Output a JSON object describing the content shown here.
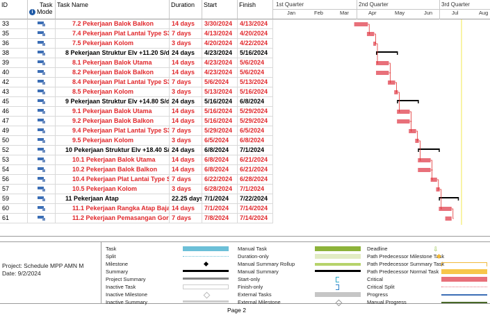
{
  "columns": {
    "id": "ID",
    "mode_line1": "Task",
    "mode_line2": "Mode",
    "name": "Task Name",
    "duration": "Duration",
    "start": "Start",
    "finish": "Finish"
  },
  "timescale": {
    "quarters": [
      "1st Quarter",
      "2nd Quarter",
      "3rd Quarter"
    ],
    "months": [
      "Jan",
      "Feb",
      "Mar",
      "Apr",
      "May",
      "Jun",
      "Jul",
      "Aug"
    ]
  },
  "tasks": [
    {
      "id": "33",
      "name": "7.2 Pekerjaan Balok Balkon",
      "duration": "14 days",
      "start": "3/30/2024",
      "finish": "4/13/2024",
      "type": "task"
    },
    {
      "id": "35",
      "name": "7.4 Pekerjaan Plat Lantai Type S3",
      "duration": "7 days",
      "start": "4/13/2024",
      "finish": "4/20/2024",
      "type": "task"
    },
    {
      "id": "36",
      "name": "7.5 Pekerjaan Kolom",
      "duration": "3 days",
      "start": "4/20/2024",
      "finish": "4/22/2024",
      "type": "task"
    },
    {
      "id": "38",
      "name": "8 Pekerjaan Struktur Elv +11.20  S/d +1(",
      "duration": "24 days",
      "start": "4/23/2024",
      "finish": "5/16/2024",
      "type": "summary"
    },
    {
      "id": "39",
      "name": "8.1 Pekerjaan Balok Utama",
      "duration": "14 days",
      "start": "4/23/2024",
      "finish": "5/6/2024",
      "type": "task"
    },
    {
      "id": "40",
      "name": "8.2 Pekerjaan Balok Balkon",
      "duration": "14 days",
      "start": "4/23/2024",
      "finish": "5/6/2024",
      "type": "task"
    },
    {
      "id": "42",
      "name": "8.4 Pekerjaan Plat Lantai Type S3",
      "duration": "7 days",
      "start": "5/6/2024",
      "finish": "5/13/2024",
      "type": "task"
    },
    {
      "id": "43",
      "name": "8.5 Pekerjaan Kolom",
      "duration": "3 days",
      "start": "5/13/2024",
      "finish": "5/16/2024",
      "type": "task"
    },
    {
      "id": "45",
      "name": "9 Pekerjaan Struktur Elv +14.80  S/d +1!",
      "duration": "24 days",
      "start": "5/16/2024",
      "finish": "6/8/2024",
      "type": "summary"
    },
    {
      "id": "46",
      "name": "9.1 Pekerjaan Balok Utama",
      "duration": "14 days",
      "start": "5/16/2024",
      "finish": "5/29/2024",
      "type": "task"
    },
    {
      "id": "47",
      "name": "9.2 Pekerjaan Balok Balkon",
      "duration": "14 days",
      "start": "5/16/2024",
      "finish": "5/29/2024",
      "type": "task"
    },
    {
      "id": "49",
      "name": "9.4 Pekerjaan Plat Lantai Type S3",
      "duration": "7 days",
      "start": "5/29/2024",
      "finish": "6/5/2024",
      "type": "task"
    },
    {
      "id": "50",
      "name": "9.5 Pekerjaan Kolom",
      "duration": "3 days",
      "start": "6/5/2024",
      "finish": "6/8/2024",
      "type": "task"
    },
    {
      "id": "52",
      "name": "10 Pekerjaan Struktur Elv +18.40  S/d +2",
      "duration": "24 days",
      "start": "6/8/2024",
      "finish": "7/1/2024",
      "type": "summary"
    },
    {
      "id": "53",
      "name": "10.1 Pekerjaan Balok Utama",
      "duration": "14 days",
      "start": "6/8/2024",
      "finish": "6/21/2024",
      "type": "task"
    },
    {
      "id": "54",
      "name": "10.2 Pekerjaan Balok Balkon",
      "duration": "14 days",
      "start": "6/8/2024",
      "finish": "6/21/2024",
      "type": "task"
    },
    {
      "id": "56",
      "name": "10.4 Pekerjaan Plat Lantai Type S3",
      "duration": "7 days",
      "start": "6/22/2024",
      "finish": "6/28/2024",
      "type": "task"
    },
    {
      "id": "57",
      "name": "10.5 Pekerjaan Kolom",
      "duration": "3 days",
      "start": "6/28/2024",
      "finish": "7/1/2024",
      "type": "task"
    },
    {
      "id": "59",
      "name": "11 Pekerjaan Atap",
      "duration": "22.25 days",
      "start": "7/1/2024",
      "finish": "7/22/2024",
      "type": "summary"
    },
    {
      "id": "60",
      "name": "11.1 Pekerjaan Rangka Atap Baja",
      "duration": "14 days",
      "start": "7/1/2024",
      "finish": "7/14/2024",
      "type": "task"
    },
    {
      "id": "61",
      "name": "11.2 Pekerjaan Pemasangan Gording",
      "duration": "7 days",
      "start": "7/8/2024",
      "finish": "7/14/2024",
      "type": "task"
    }
  ],
  "project": {
    "label": "Project: Schedule MPP AMN M",
    "date": "Date: 9/2/2024"
  },
  "legend": {
    "col1": [
      "Task",
      "Split",
      "Milestone",
      "Summary",
      "Project Summary",
      "Inactive Task",
      "Inactive Milestone",
      "Inactive Summary"
    ],
    "col2": [
      "Manual Task",
      "Duration-only",
      "Manual Summary Rollup",
      "Manual Summary",
      "Start-only",
      "Finish-only",
      "External Tasks",
      "External Milestone"
    ],
    "col3": [
      "Deadline",
      "Path Predecessor Milestone Task",
      "Path Predecessor Summary Task",
      "Path Predecessor Normal Task",
      "Critical",
      "Critical Split",
      "Progress",
      "Manual Progress"
    ]
  },
  "footer": {
    "page": "Page 2"
  },
  "colors": {
    "critical": "#e8707a",
    "critical_text": "#e0272b",
    "task": "#6cc0d8",
    "manual": "#a7c93b",
    "deadline_line": "#f2e84c"
  }
}
